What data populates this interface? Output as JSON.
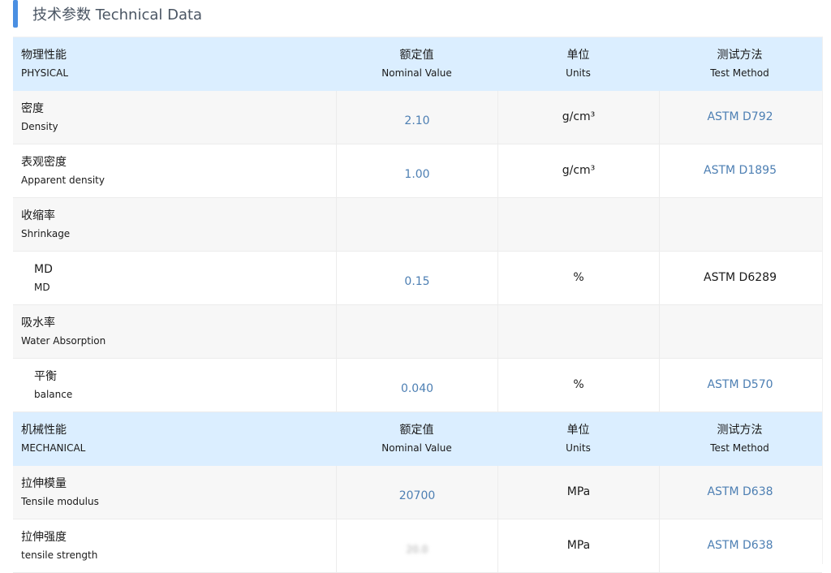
{
  "section": {
    "title": "技术参数 Technical Data",
    "accent_color": "#4a8fe2"
  },
  "colors": {
    "header_bg": "#dbeeff",
    "value_text": "#4d7fb3",
    "link_text": "#4d7fb3"
  },
  "headers": {
    "physical": {
      "property_zh": "物理性能",
      "property_en": "PHYSICAL",
      "nominal_zh": "额定值",
      "nominal_en": "Nominal Value",
      "units_zh": "单位",
      "units_en": "Units",
      "method_zh": "测试方法",
      "method_en": "Test Method"
    },
    "mechanical": {
      "property_zh": "机械性能",
      "property_en": "MECHANICAL",
      "nominal_zh": "额定值",
      "nominal_en": "Nominal Value",
      "units_zh": "单位",
      "units_en": "Units",
      "method_zh": "测试方法",
      "method_en": "Test Method"
    }
  },
  "rows": {
    "density": {
      "zh": "密度",
      "en": "Density",
      "value": "2.10",
      "unit": "g/cm³",
      "method": "ASTM D792"
    },
    "apparent_density": {
      "zh": "表观密度",
      "en": "Apparent density",
      "value": "1.00",
      "unit": "g/cm³",
      "method": "ASTM D1895"
    },
    "shrinkage": {
      "zh": "收缩率",
      "en": "Shrinkage"
    },
    "md": {
      "zh": "MD",
      "en": "MD",
      "value": "0.15",
      "unit": "%",
      "method": "ASTM D6289"
    },
    "water_absorption": {
      "zh": "吸水率",
      "en": "Water Absorption"
    },
    "balance": {
      "zh": "平衡",
      "en": "balance",
      "value": "0.040",
      "unit": "%",
      "method": "ASTM D570"
    },
    "tensile_modulus": {
      "zh": "拉伸模量",
      "en": "Tensile modulus",
      "value": "20700",
      "unit": "MPa",
      "method": "ASTM D638"
    },
    "tensile_strength": {
      "zh": "拉伸强度",
      "en": "tensile strength",
      "value": "20.0",
      "unit": "MPa",
      "method": "ASTM D638"
    }
  }
}
